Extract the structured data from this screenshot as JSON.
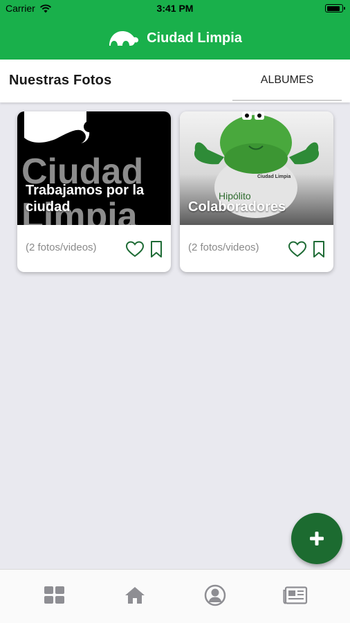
{
  "status_bar": {
    "carrier": "Carrier",
    "time": "3:41 PM"
  },
  "app_bar": {
    "title": "Ciudad Limpia"
  },
  "tabs": {
    "photos_label": "Nuestras Fotos",
    "albums_label": "ALBUMES"
  },
  "albums": [
    {
      "title": "Trabajamos por la ciudad",
      "count": "(2 fotos/videos)",
      "thumb_text": "Ciudad Limpia"
    },
    {
      "title": "Colaboradores",
      "count": "(2 fotos/videos)",
      "thumb_text": "Hipólito",
      "shirt_text": "Ciudad Limpia"
    }
  ],
  "fab": {
    "icon": "plus-icon"
  },
  "bottom_nav": [
    {
      "icon": "grid-icon"
    },
    {
      "icon": "home-icon"
    },
    {
      "icon": "profile-icon"
    },
    {
      "icon": "newspaper-icon"
    }
  ],
  "colors": {
    "brand_green": "#19b04b",
    "dark_green": "#1c6b30",
    "icon_green": "#1e6b35",
    "nav_gray": "#8e8e93"
  }
}
